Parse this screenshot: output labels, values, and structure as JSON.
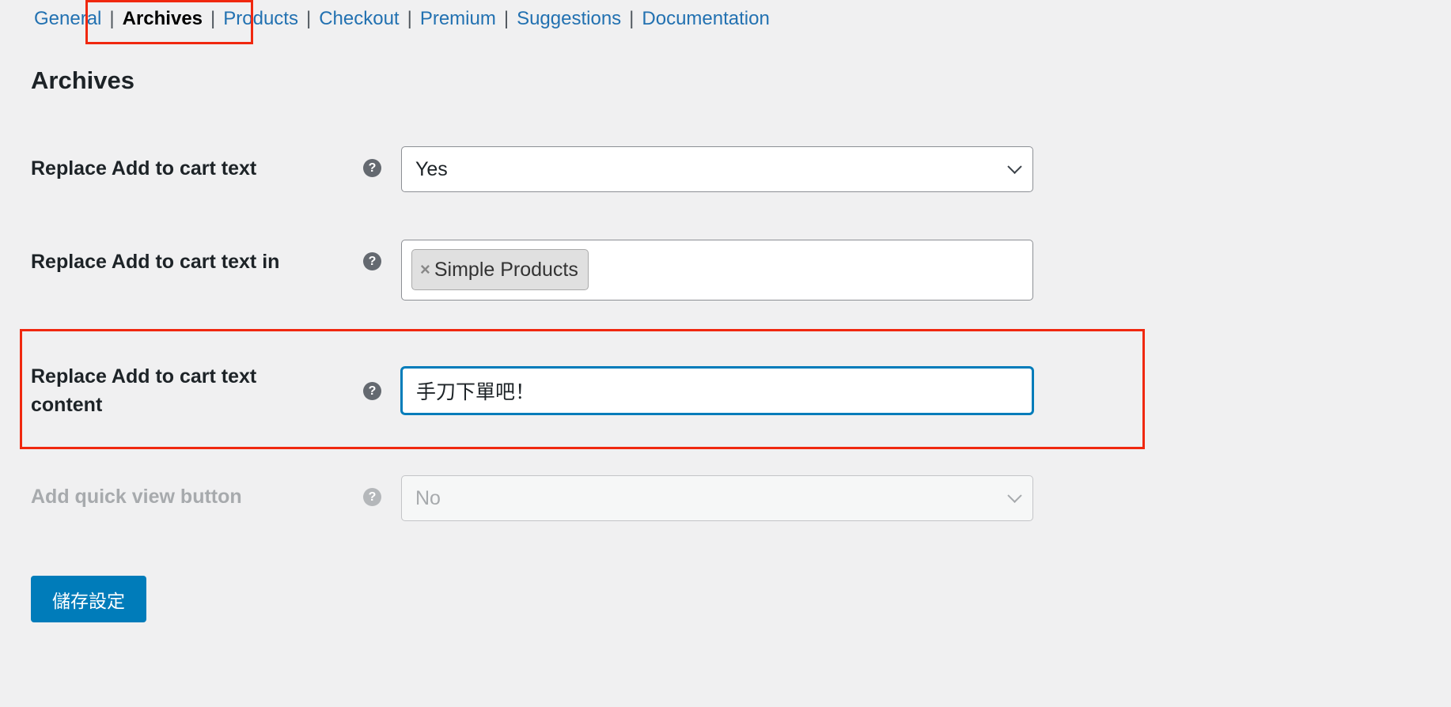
{
  "nav": {
    "items": [
      {
        "label": "General"
      },
      {
        "label": "Archives",
        "current": true
      },
      {
        "label": "Products"
      },
      {
        "label": "Checkout"
      },
      {
        "label": "Premium"
      },
      {
        "label": "Suggestions"
      },
      {
        "label": "Documentation"
      }
    ],
    "separator": "|"
  },
  "section_title": "Archives",
  "help_glyph": "?",
  "fields": [
    {
      "label": "Replace Add to cart text",
      "type": "select",
      "value": "Yes"
    },
    {
      "label": "Replace Add to cart text in",
      "type": "multiselect",
      "tags": [
        {
          "remove": "×",
          "label": "Simple Products"
        }
      ]
    },
    {
      "label": "Replace Add to cart text content",
      "type": "text",
      "value": "手刀下單吧！"
    },
    {
      "label": "Add quick view button",
      "type": "select",
      "value": "No",
      "disabled": true
    }
  ],
  "save_label": "儲存設定",
  "colors": {
    "accent": "#007cba",
    "link": "#2271b1",
    "highlight": "#f0280f",
    "focus": "#007cba"
  }
}
